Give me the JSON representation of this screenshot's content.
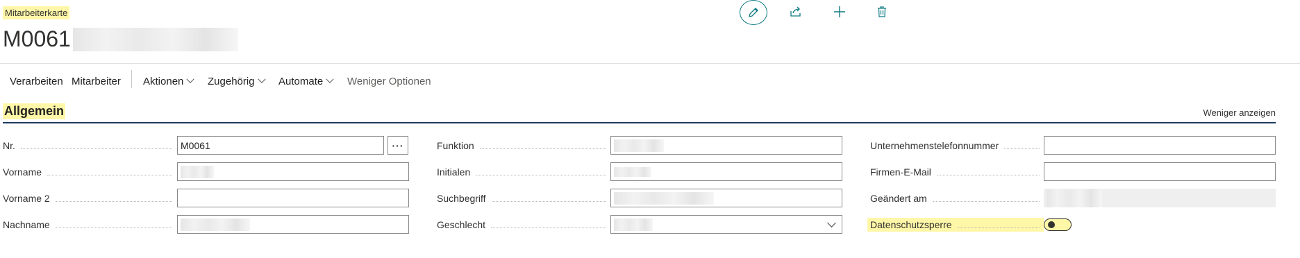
{
  "page": {
    "caption": "Mitarbeiterkarte",
    "title": "M0061 ·"
  },
  "toolbar_icons": [
    "edit-icon",
    "share-icon",
    "add-icon",
    "delete-icon"
  ],
  "actions": [
    {
      "label": "Verarbeiten"
    },
    {
      "label": "Mitarbeiter"
    },
    {
      "label": "Aktionen",
      "dropdown": true
    },
    {
      "label": "Zugehörig",
      "dropdown": true
    },
    {
      "label": "Automate",
      "dropdown": true
    },
    {
      "label": "Weniger Optionen"
    }
  ],
  "section": {
    "title": "Allgemein",
    "toggle_label": "Weniger anzeigen"
  },
  "fields": {
    "nr": {
      "label": "Nr.",
      "value": "M0061"
    },
    "vorname": {
      "label": "Vorname",
      "value": ""
    },
    "vorname2": {
      "label": "Vorname 2",
      "value": ""
    },
    "nachname": {
      "label": "Nachname",
      "value": ""
    },
    "funktion": {
      "label": "Funktion",
      "value": ""
    },
    "initialen": {
      "label": "Initialen",
      "value": ""
    },
    "suchbegriff": {
      "label": "Suchbegriff",
      "value": ""
    },
    "geschlecht": {
      "label": "Geschlecht",
      "value": ""
    },
    "telefon": {
      "label": "Unternehmenstelefonnummer",
      "value": ""
    },
    "email": {
      "label": "Firmen-E-Mail",
      "value": ""
    },
    "geaendert": {
      "label": "Geändert am",
      "value": ""
    },
    "datenschutz": {
      "label": "Datenschutzsperre",
      "value": "off"
    }
  },
  "colors": {
    "accent": "#0e7a82",
    "highlight": "#fff7a8",
    "section_line": "#1d3a5f"
  }
}
